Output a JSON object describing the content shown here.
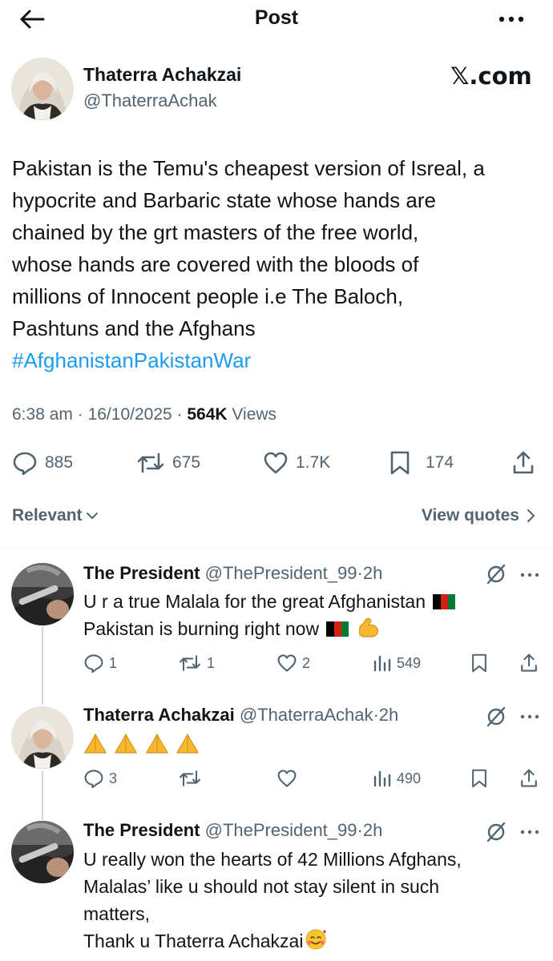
{
  "header": {
    "title": "Post"
  },
  "post": {
    "author_name": "Thaterra Achakzai",
    "author_handle": "@ThaterraAchak",
    "source_label": "𝕏.com",
    "body_lines": [
      "Pakistan is the Temu's cheapest version of Isreal, a",
      "hypocrite and Barbaric state whose hands are",
      "chained by the grt masters of the free world,",
      "whose hands are covered with the bloods of",
      "millions of Innocent people i.e The Baloch,",
      "Pashtuns and the Afghans"
    ],
    "hashtag": "#AfghanistanPakistanWar",
    "time": "6:38 am",
    "date": "16/10/2025",
    "views_count": "564K",
    "views_label": "Views",
    "separator": "·",
    "replies": "885",
    "reposts": "675",
    "likes": "1.7K",
    "bookmarks": "174"
  },
  "tabs": {
    "sort_label": "Relevant",
    "view_quotes_label": "View quotes"
  },
  "replies": [
    {
      "name": "The President",
      "handle": "@ThePresident_99",
      "time": "2h",
      "line1": "U r a true Malala for the great Afghanistan",
      "line2": "Pakistan is burning right now",
      "replies": "1",
      "reposts": "1",
      "likes": "2",
      "views": "549"
    },
    {
      "name": "Thaterra Achakzai",
      "handle": "@ThaterraAchak",
      "time": "2h",
      "replies": "3",
      "reposts": "",
      "likes": "",
      "views": "490"
    },
    {
      "name": "The President",
      "handle": "@ThePresident_99",
      "time": "2h",
      "lines": [
        "U really won the hearts of 42 Millions Afghans,",
        "Malalas’ like u should not stay silent in such",
        "matters,",
        "Thank u Thaterra Achakzai"
      ]
    }
  ],
  "colors": {
    "text": "#0f1419",
    "secondary": "#536471",
    "link": "#1d9bf0",
    "divider": "#eff3f4"
  }
}
